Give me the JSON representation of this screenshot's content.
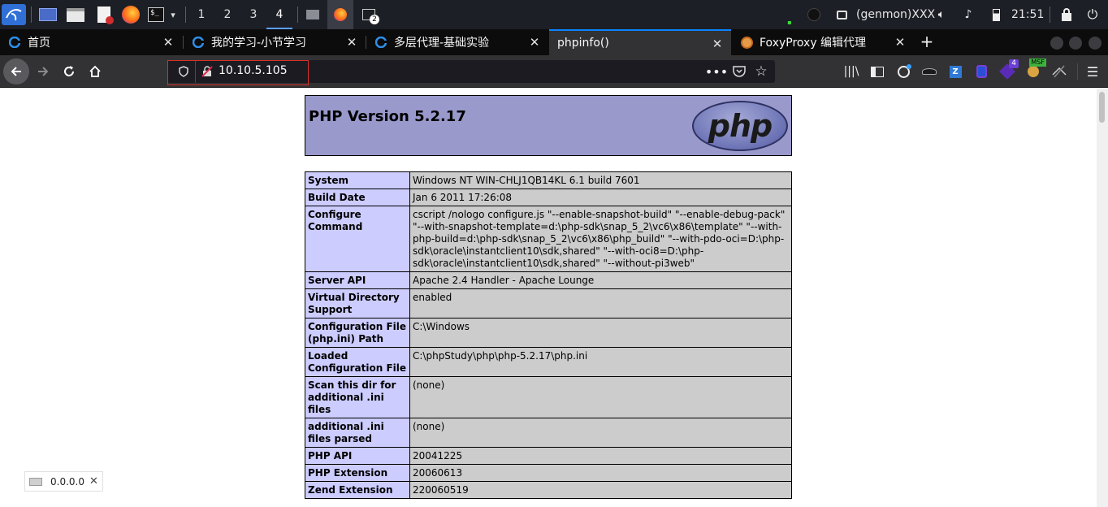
{
  "os_panel": {
    "workspaces": [
      "1",
      "2",
      "3",
      "4"
    ],
    "active_workspace": "4",
    "genmon": "(genmon)XXX",
    "clock": "21:51"
  },
  "tabs": [
    {
      "title": "首页",
      "icon": "edu-icon"
    },
    {
      "title": "我的学习-小节学习",
      "icon": "edu-icon"
    },
    {
      "title": "多层代理-基础实验",
      "icon": "edu-icon"
    },
    {
      "title": "phpinfo()",
      "icon": "none",
      "active": true
    },
    {
      "title": "FoxyProxy 编辑代理",
      "icon": "foxyproxy-icon"
    }
  ],
  "nav": {
    "url": "10.10.5.105",
    "extension_badges": {
      "badge_purple": "4",
      "msf": "MSF"
    }
  },
  "page": {
    "header_title": "PHP Version 5.2.17",
    "logo_text": "php",
    "rows": [
      {
        "label": "System",
        "value": "Windows NT WIN-CHLJ1QB14KL 6.1 build 7601"
      },
      {
        "label": "Build Date",
        "value": "Jan 6 2011 17:26:08"
      },
      {
        "label": "Configure Command",
        "value": "cscript /nologo configure.js \"--enable-snapshot-build\" \"--enable-debug-pack\" \"--with-snapshot-template=d:\\php-sdk\\snap_5_2\\vc6\\x86\\template\" \"--with-php-build=d:\\php-sdk\\snap_5_2\\vc6\\x86\\php_build\" \"--with-pdo-oci=D:\\php-sdk\\oracle\\instantclient10\\sdk,shared\" \"--with-oci8=D:\\php-sdk\\oracle\\instantclient10\\sdk,shared\" \"--without-pi3web\""
      },
      {
        "label": "Server API",
        "value": "Apache 2.4 Handler - Apache Lounge"
      },
      {
        "label": "Virtual Directory Support",
        "value": "enabled"
      },
      {
        "label": "Configuration File (php.ini) Path",
        "value": "C:\\Windows"
      },
      {
        "label": "Loaded Configuration File",
        "value": "C:\\phpStudy\\php\\php-5.2.17\\php.ini"
      },
      {
        "label": "Scan this dir for additional .ini files",
        "value": "(none)"
      },
      {
        "label": "additional .ini files parsed",
        "value": "(none)"
      },
      {
        "label": "PHP API",
        "value": "20041225"
      },
      {
        "label": "PHP Extension",
        "value": "20060613"
      },
      {
        "label": "Zend Extension",
        "value": "220060519"
      }
    ]
  },
  "popup": {
    "text": "0.0.0.0"
  },
  "colors": {
    "header_bg": "#9999cc",
    "label_bg": "#ccccff",
    "value_bg": "#cccccc",
    "tab_accent": "#0a84ff",
    "highlight_border": "#d9302a"
  }
}
